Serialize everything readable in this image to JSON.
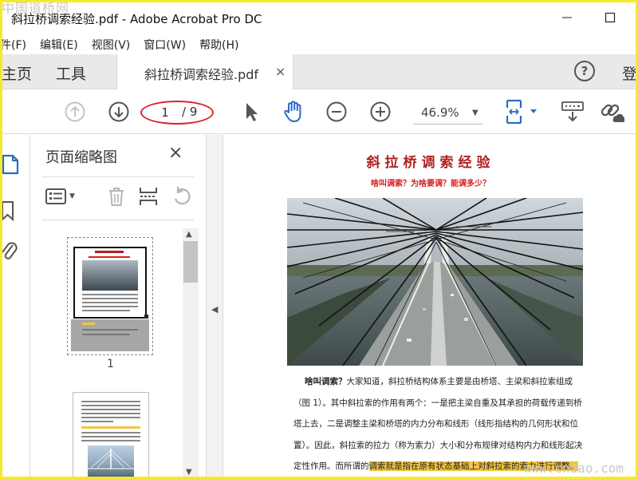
{
  "window": {
    "title": "斜拉桥调索经验.pdf - Adobe Acrobat Pro DC"
  },
  "watermark": {
    "top_left": "中国道桥网",
    "bottom_right": "www.cndao.com"
  },
  "menu": {
    "items": [
      "件(F)",
      "编辑(E)",
      "视图(V)",
      "窗口(W)",
      "帮助(H)"
    ]
  },
  "tabs": {
    "home": "主页",
    "tools": "工具",
    "document": "斜拉桥调索经验.pdf",
    "close": "×",
    "help": "?",
    "login": "登"
  },
  "toolbar": {
    "page_current": "1",
    "page_total": "/ 9",
    "zoom": "46.9%"
  },
  "thumbnails": {
    "title": "页面缩略图",
    "close": "×",
    "page_label": "1"
  },
  "document": {
    "title": "斜拉桥调索经验",
    "subtitle": "啥叫调索？为啥要调？能调多少？",
    "para_bold": "啥叫调索？",
    "para_text": "大家知道，斜拉桥结构体系主要是由桥塔、主梁和斜拉索组成（图 1）。其中斜拉索的作用有两个：一是把主梁自重及其承担的荷载传递到桥塔上去，二是调整主梁和桥塔的内力分布和线形（线形指结构的几何形状和位置）。因此，斜拉索的拉力（称为索力）大小和分布规律对结构内力和线形起决定性作用。而所谓的",
    "para_highlight": "调索就是指在原有状态基础上对斜拉索的索力进行调整。"
  },
  "icons": {
    "prev_page": "arrow-up-circle-icon",
    "next_page": "arrow-down-circle-icon",
    "select": "cursor-arrow-icon",
    "hand": "hand-icon",
    "zoom_out": "minus-circle-icon",
    "zoom_in": "plus-circle-icon",
    "fit": "fit-page-icon",
    "keyboard": "keyboard-icon",
    "share": "link-icon"
  },
  "colors": {
    "accent_blue": "#2b6cc4",
    "annotation_red": "#d9262b",
    "title_red": "#b0201f",
    "highlight": "#f4c542"
  }
}
